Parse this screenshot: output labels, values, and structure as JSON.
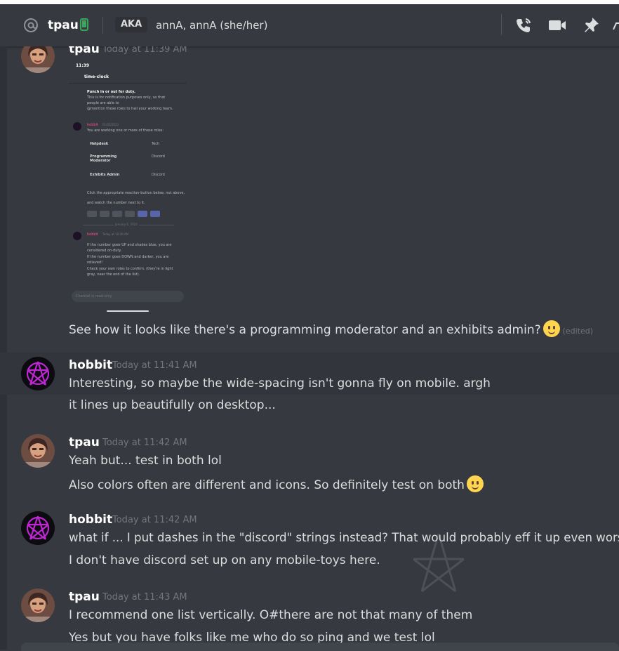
{
  "header": {
    "dm_name": "tpau",
    "aka_label": "AKA",
    "aka_names": "annA, annA (she/her)"
  },
  "messages": [
    {
      "author": "tpau",
      "timestamp": "Today at 11:39 AM",
      "text": "See how it looks like there's a programming moderator and an exhibits admin?",
      "edited": "(edited)"
    },
    {
      "author": "hobbit",
      "timestamp": "Today at 11:41 AM",
      "lines": [
        "Interesting, so maybe the wide-spacing isn't gonna fly on mobile.  argh",
        "it lines up beautifully on desktop..."
      ]
    },
    {
      "author": "tpau",
      "timestamp": "Today at 11:42 AM",
      "lines": [
        "Yeah but... test in both lol",
        "Also colors often are different and icons. So definitely test on both"
      ]
    },
    {
      "author": "hobbit",
      "timestamp": "Today at 11:42 AM",
      "lines": [
        "what if ... I put dashes in the \"discord\" strings instead?  That would probably eff it up even worse",
        "I don't have discord set up on any mobile-toys here."
      ]
    },
    {
      "author": "tpau",
      "timestamp": "Today at 11:43 AM",
      "lines": [
        "I recommend one list vertically. O#there are not that many of them",
        "Yes but you have folks like me who do so ping and we test lol"
      ]
    }
  ],
  "phone_screenshot": {
    "status_time": "11:39",
    "channel": "time-clock",
    "intro": [
      "Punch in or out for duty.",
      "This is for notification purposes only, so that",
      "people are able to",
      "@mention these roles to hail your working team."
    ],
    "bot_name": "hobbit",
    "bot_time1": "01/05/2023",
    "roles_intro": "You are working one or more of these roles:",
    "roles": [
      {
        "name": "Helpdesk",
        "alt": "Tech"
      },
      {
        "name": "Programming Moderator",
        "alt": "Discord"
      },
      {
        "name": "Exhibits Admin",
        "alt": "Discord"
      }
    ],
    "instructions": [
      "Click the appropriate reaction-button below, not above,",
      "and watch the number next to it."
    ],
    "date_divider": "January 6, 2023",
    "bot_time2": "Today at 10:39 AM",
    "notes": [
      "If the number goes UP and shades blue, you are",
      "considered on-duty.",
      "If the number goes DOWN and darker, you are",
      "relieved!",
      "Check your own roles to confirm. (they're in light",
      "gray, near the end of the list)."
    ],
    "input_placeholder": "Channel is read-only"
  },
  "colors": {
    "background": "#36393f",
    "author": "#ffffff",
    "timestamp": "#72767d",
    "text": "#dcddde",
    "hobbit_avatar_accent": "#c026d3",
    "online_status": "#3ba55d"
  },
  "icons": [
    "at-icon",
    "mobile-online-icon",
    "voice-call-icon",
    "video-call-icon",
    "pin-icon"
  ]
}
